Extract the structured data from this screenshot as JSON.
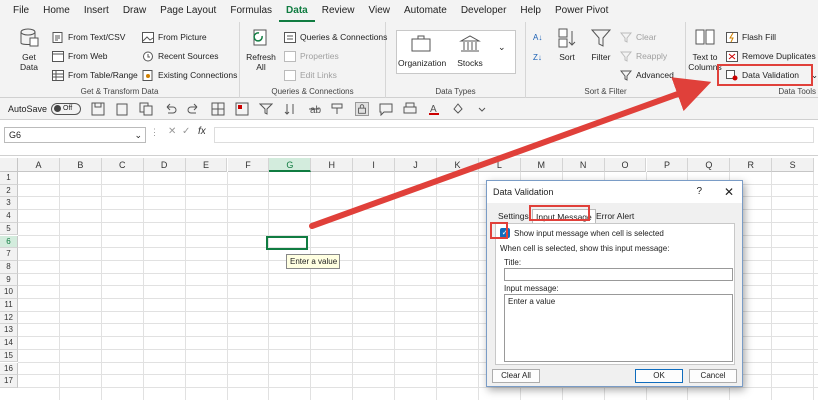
{
  "menu": {
    "tabs": [
      "File",
      "Home",
      "Insert",
      "Draw",
      "Page Layout",
      "Formulas",
      "Data",
      "Review",
      "View",
      "Automate",
      "Developer",
      "Help",
      "Power Pivot"
    ],
    "active": "Data"
  },
  "ribbon": {
    "get_transform": {
      "get_data": "Get\nData",
      "from_text_csv": "From Text/CSV",
      "from_web": "From Web",
      "from_table_range": "From Table/Range",
      "from_picture": "From Picture",
      "recent_sources": "Recent Sources",
      "existing_connections": "Existing Connections",
      "label": "Get & Transform Data"
    },
    "queries": {
      "refresh_all": "Refresh\nAll",
      "queries_connections": "Queries & Connections",
      "properties": "Properties",
      "edit_links": "Edit Links",
      "label": "Queries & Connections"
    },
    "data_types": {
      "organization": "Organization",
      "stocks": "Stocks",
      "label": "Data Types"
    },
    "sort_filter": {
      "sort": "Sort",
      "filter": "Filter",
      "clear": "Clear",
      "reapply": "Reapply",
      "advanced": "Advanced",
      "label": "Sort & Filter"
    },
    "data_tools": {
      "text_to_columns": "Text to\nColumns",
      "flash_fill": "Flash Fill",
      "remove_duplicates": "Remove Duplicates",
      "data_validation": "Data Validation",
      "label": "Data Tools"
    }
  },
  "qat": {
    "autosave": "AutoSave",
    "toggle": "Off"
  },
  "formula_bar": {
    "name_box": "G6",
    "fx": "fx",
    "value": ""
  },
  "grid": {
    "columns": [
      "A",
      "B",
      "C",
      "D",
      "E",
      "F",
      "G",
      "H",
      "I",
      "J",
      "K",
      "L",
      "M",
      "N",
      "O",
      "P",
      "Q",
      "R",
      "S"
    ],
    "rows": [
      "1",
      "2",
      "3",
      "4",
      "5",
      "6",
      "7",
      "8",
      "9",
      "10",
      "11",
      "12",
      "13",
      "14",
      "15",
      "16",
      "17"
    ],
    "selected_column": "G",
    "selected_row": "6",
    "tooltip": "Enter a value"
  },
  "dialog": {
    "title": "Data Validation",
    "help": "?",
    "close": "✕",
    "tabs": [
      "Settings",
      "Input Message",
      "Error Alert"
    ],
    "active_tab": "Input Message",
    "show_message_label": "Show input message when cell is selected",
    "show_message_checked": true,
    "when_selected_label": "When cell is selected, show this input message:",
    "title_label": "Title:",
    "title_value": "",
    "input_message_label": "Input message:",
    "input_message_value": "Enter a value",
    "clear_all": "Clear All",
    "ok": "OK",
    "cancel": "Cancel"
  },
  "colors": {
    "excel_green": "#107c41",
    "annotation_red": "#e0403a",
    "checkbox_blue": "#0f6cbd"
  }
}
